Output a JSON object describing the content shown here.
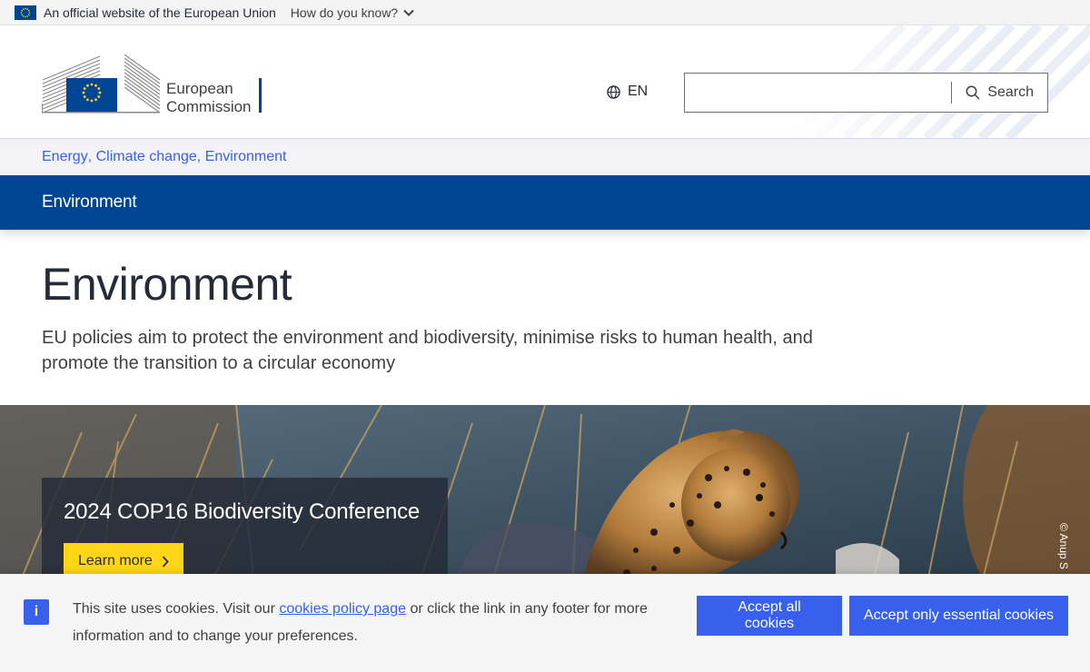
{
  "topbar": {
    "official_text": "An official website of the European Union",
    "how_know": "How do you know?"
  },
  "header": {
    "logo_line1": "European",
    "logo_line2": "Commission",
    "lang": "EN",
    "search_placeholder": "",
    "search_label": "Search"
  },
  "breadcrumb": {
    "items": [
      "Energy",
      "Climate change",
      "Environment"
    ]
  },
  "sitenav": {
    "title": "Environment"
  },
  "page": {
    "title": "Environment",
    "description": "EU policies aim to protect the environment and biodiversity, minimise risks to human health, and promote the transition to a circular economy"
  },
  "banner": {
    "heading": "2024 COP16 Biodiversity Conference",
    "button": "Learn more",
    "credit": "© Anup S"
  },
  "cookie": {
    "icon": "i",
    "text_before": "This site uses cookies. Visit our ",
    "link": "cookies policy page",
    "text_after": " or click the link in any footer for more information and to change your preferences.",
    "accept_all": "Accept all cookies",
    "accept_essential": "Accept only essential cookies"
  },
  "colors": {
    "primary": "#004494",
    "link": "#3860ed",
    "accent": "#ffd617"
  },
  "icons": [
    "eu-flag-icon",
    "chevron-down-icon",
    "globe-icon",
    "search-icon",
    "chevron-right-icon",
    "info-icon"
  ]
}
